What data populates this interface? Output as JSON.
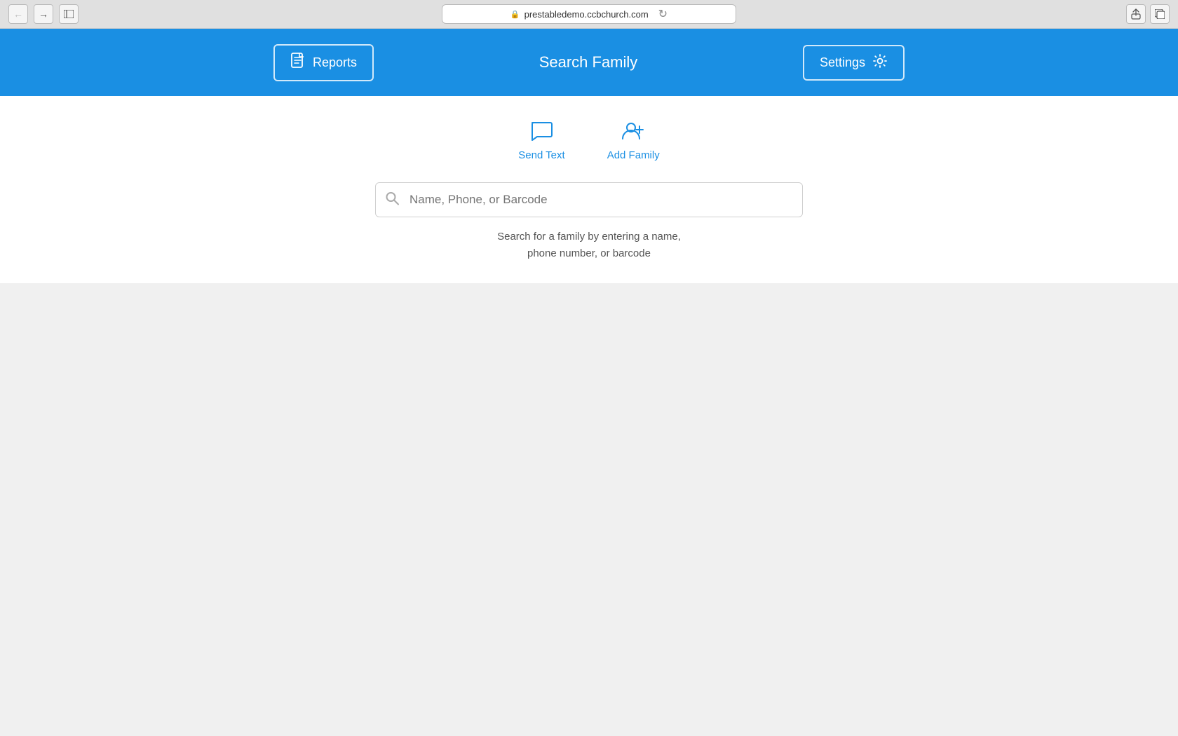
{
  "browser": {
    "url": "prestabledemo.ccbchurch.com",
    "back_btn": "←",
    "forward_btn": "→",
    "sidebar_btn": "⊡",
    "reload_btn": "↻",
    "share_btn": "⬆",
    "tabs_btn": "⧉"
  },
  "nav": {
    "reports_label": "Reports",
    "title": "Search Family",
    "settings_label": "Settings"
  },
  "actions": {
    "send_text_label": "Send Text",
    "add_family_label": "Add Family"
  },
  "search": {
    "placeholder": "Name, Phone, or Barcode",
    "hint_line1": "Search for a family by entering a name,",
    "hint_line2": "phone number, or barcode"
  },
  "colors": {
    "accent": "#1a8fe3",
    "white": "#ffffff",
    "text_dark": "#333333",
    "text_hint": "#555555",
    "text_muted": "#999999",
    "border": "#d0d0d0"
  }
}
